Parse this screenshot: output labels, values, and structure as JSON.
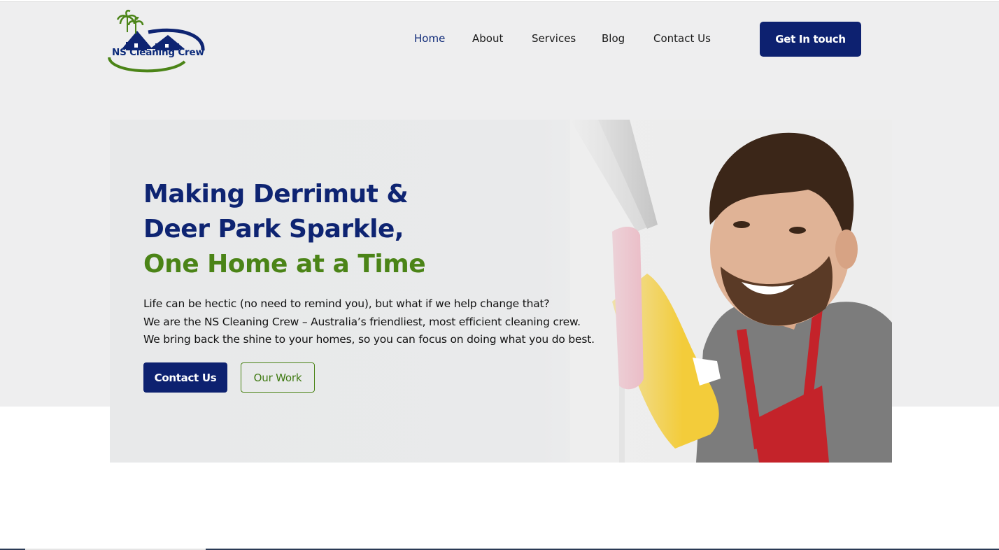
{
  "brand": {
    "name": "NS Cleaning Crew",
    "colors": {
      "navy": "#0d2170",
      "green": "#4b8417",
      "background": "#eeeeef"
    }
  },
  "nav": {
    "items": [
      {
        "label": "Home",
        "active": true
      },
      {
        "label": "About",
        "active": false
      },
      {
        "label": "Services",
        "active": false
      },
      {
        "label": "Blog",
        "active": false
      },
      {
        "label": "Contact Us",
        "active": false
      }
    ],
    "cta_label": "Get In touch"
  },
  "hero": {
    "title_line1": "Making Derrimut &",
    "title_line2": "Deer Park Sparkle,",
    "title_line3": "One Home at a Time",
    "paragraph": [
      "Life can be hectic (no need to remind you), but what if we help change that?",
      "We are the NS Cleaning Crew – Australia’s friendliest, most efficient cleaning crew.",
      "We bring back the shine to your homes, so you can focus on doing what you do best."
    ],
    "primary_button": "Contact Us",
    "secondary_button": "Our Work",
    "image_icon": "cleaner-photo"
  }
}
